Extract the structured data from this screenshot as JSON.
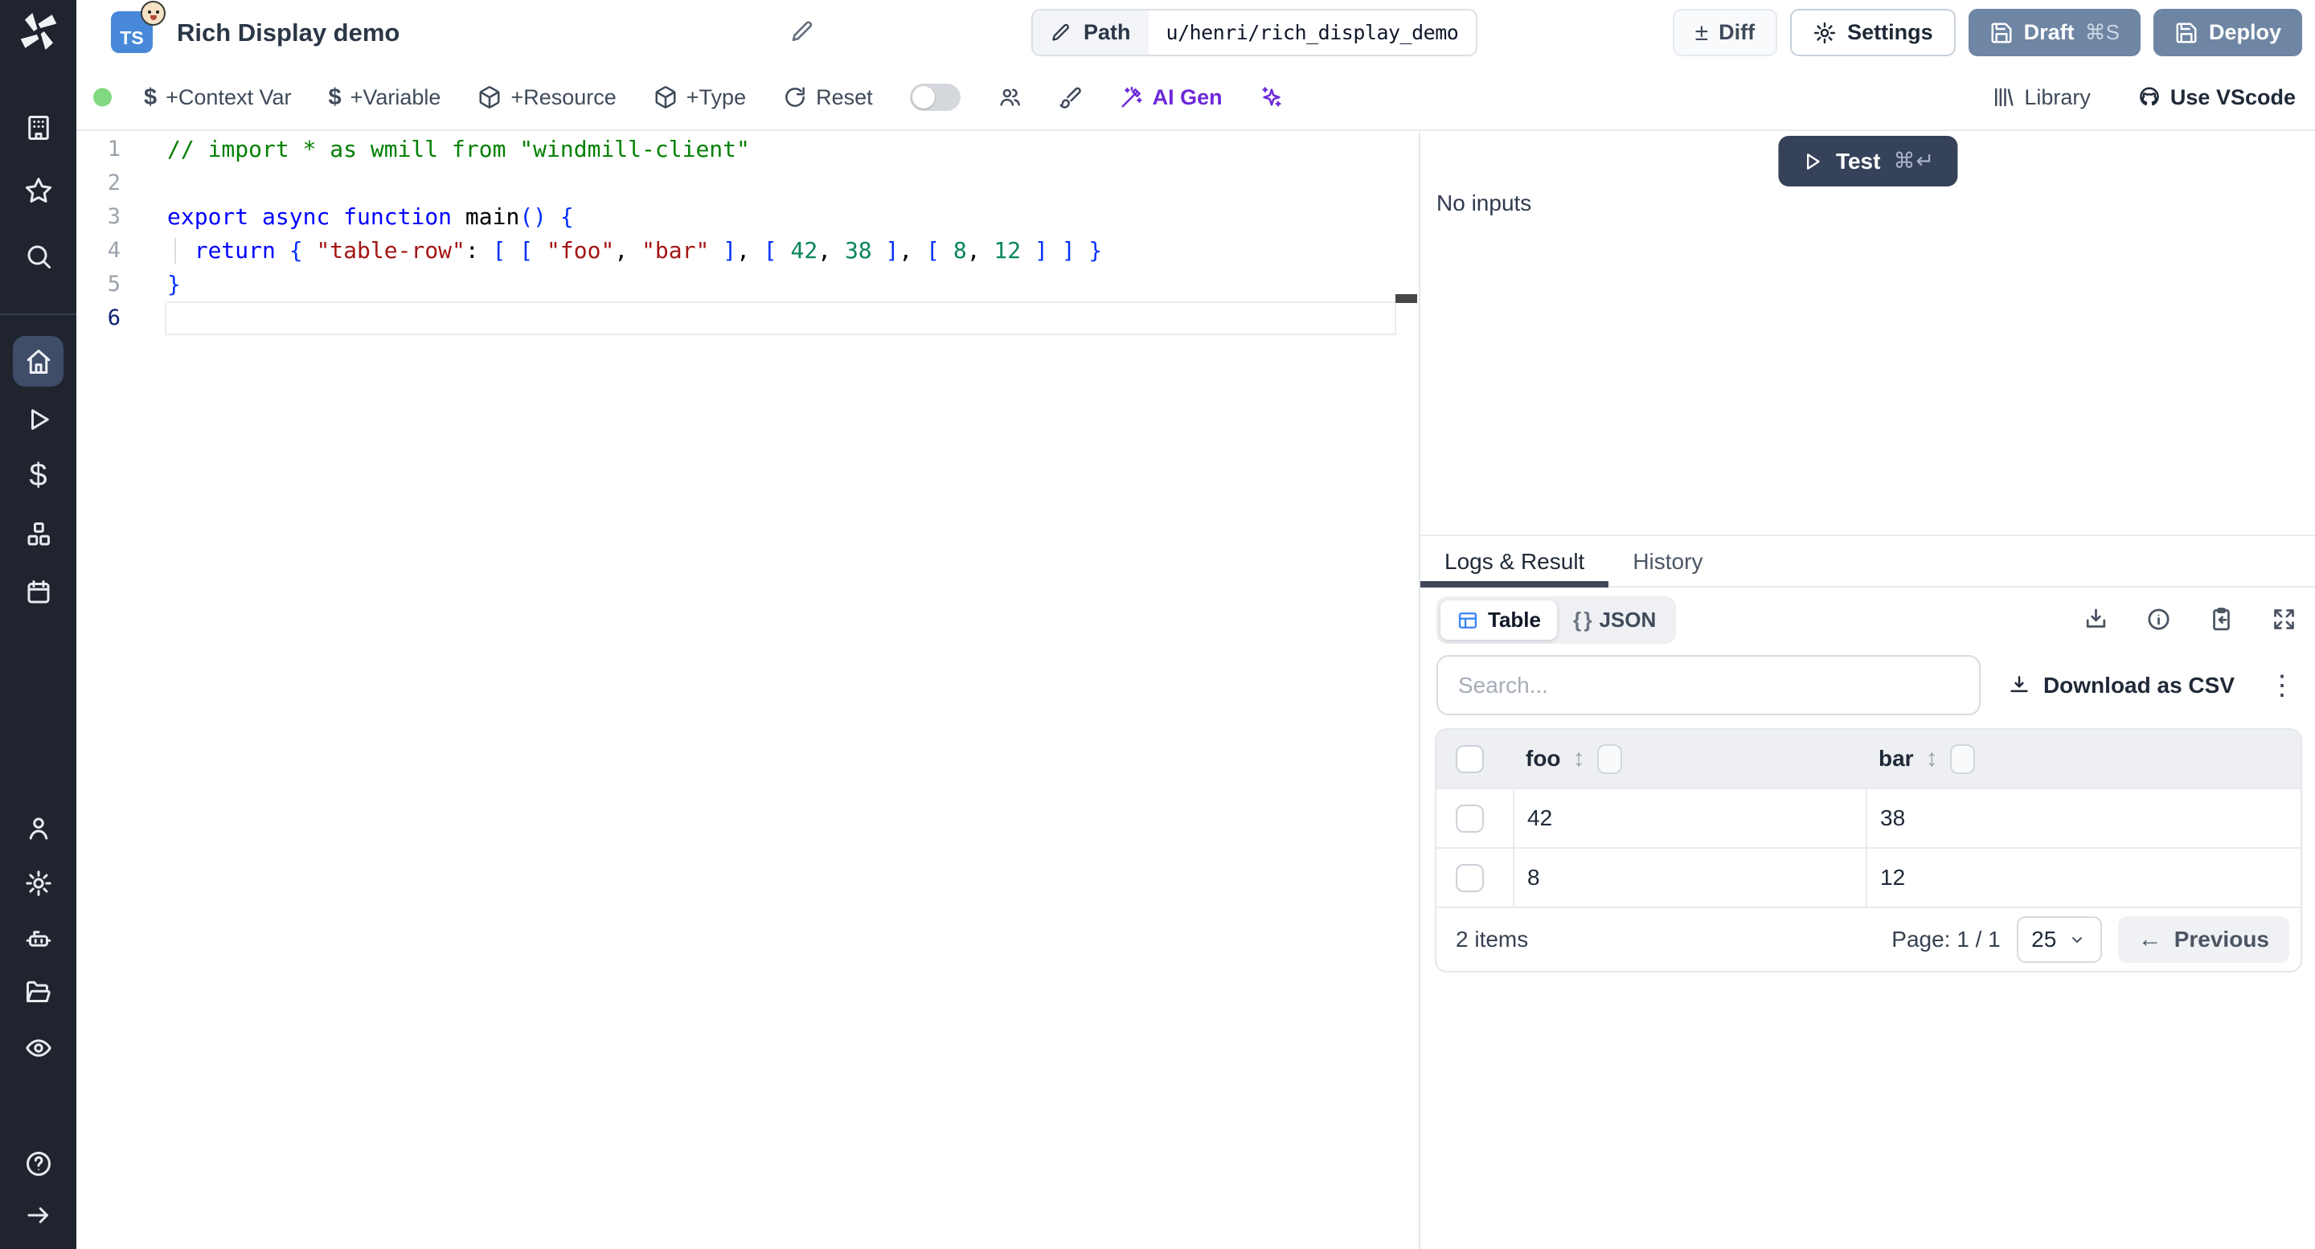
{
  "colors": {
    "sidebar_bg": "#1f242e",
    "sidebar_active_bg": "#3f4d69",
    "primary_button": "#6e85a3",
    "test_button": "#364259",
    "ai_accent": "#6d28d9",
    "table_view_icon": "#3b82f6",
    "status_dot": "#81d981",
    "ts_badge": "#4789d8",
    "tab_underline": "#3f4856"
  },
  "header": {
    "app_title": "Rich Display demo",
    "lang_badge": "TS",
    "path_label": "Path",
    "path_value": "u/henri/rich_display_demo",
    "diff_label": "Diff",
    "diff_glyph": "±",
    "settings_label": "Settings",
    "draft_label": "Draft",
    "draft_shortcut": "⌘S",
    "deploy_label": "Deploy"
  },
  "toolbar": {
    "dollar_glyph": "$",
    "context_var_label": "+Context Var",
    "variable_label": "+Variable",
    "resource_label": "+Resource",
    "type_label": "+Type",
    "reset_label": "Reset",
    "ai_gen_label": "AI Gen",
    "library_label": "Library",
    "vscode_label": "Use VScode"
  },
  "editor": {
    "active_line": "6",
    "lines": [
      {
        "n": "1",
        "tokens": [
          [
            "comment",
            "// import * as wmill from \"windmill-client\""
          ]
        ]
      },
      {
        "n": "2",
        "tokens": []
      },
      {
        "n": "3",
        "tokens": [
          [
            "kw",
            "export"
          ],
          [
            "plain",
            " "
          ],
          [
            "kw",
            "async"
          ],
          [
            "plain",
            " "
          ],
          [
            "kw",
            "function"
          ],
          [
            "plain",
            " main"
          ],
          [
            "brk",
            "()"
          ],
          [
            "plain",
            " "
          ],
          [
            "brk",
            "{"
          ]
        ]
      },
      {
        "n": "4",
        "guide": true,
        "tokens": [
          [
            "plain",
            "  "
          ],
          [
            "kw",
            "return"
          ],
          [
            "plain",
            " "
          ],
          [
            "brk",
            "{"
          ],
          [
            "plain",
            " "
          ],
          [
            "str",
            "\"table-row\""
          ],
          [
            "plain",
            ": "
          ],
          [
            "brk",
            "["
          ],
          [
            "plain",
            " "
          ],
          [
            "brk",
            "["
          ],
          [
            "plain",
            " "
          ],
          [
            "str",
            "\"foo\""
          ],
          [
            "plain",
            ", "
          ],
          [
            "str",
            "\"bar\""
          ],
          [
            "plain",
            " "
          ],
          [
            "brk",
            "]"
          ],
          [
            "plain",
            ", "
          ],
          [
            "brk",
            "["
          ],
          [
            "plain",
            " "
          ],
          [
            "num",
            "42"
          ],
          [
            "plain",
            ", "
          ],
          [
            "num",
            "38"
          ],
          [
            "plain",
            " "
          ],
          [
            "brk",
            "]"
          ],
          [
            "plain",
            ", "
          ],
          [
            "brk",
            "["
          ],
          [
            "plain",
            " "
          ],
          [
            "num",
            "8"
          ],
          [
            "plain",
            ", "
          ],
          [
            "num",
            "12"
          ],
          [
            "plain",
            " "
          ],
          [
            "brk",
            "]"
          ],
          [
            "plain",
            " "
          ],
          [
            "brk",
            "]"
          ],
          [
            "plain",
            " "
          ],
          [
            "brk",
            "}"
          ]
        ]
      },
      {
        "n": "5",
        "tokens": [
          [
            "brk",
            "}"
          ]
        ]
      },
      {
        "n": "6",
        "tokens": []
      }
    ]
  },
  "run_panel": {
    "test_label": "Test",
    "test_shortcut": "⌘↵",
    "no_inputs_label": "No inputs"
  },
  "result_panel": {
    "tab_logs": "Logs & Result",
    "tab_history": "History",
    "view_table_label": "Table",
    "view_json_label": "JSON",
    "braces_glyph": "{ }",
    "search_placeholder": "Search...",
    "download_csv_label": "Download as CSV",
    "kebab_glyph": "⋮",
    "sort_glyph": "↕",
    "table": {
      "columns": [
        "foo",
        "bar"
      ],
      "rows": [
        [
          "42",
          "38"
        ],
        [
          "8",
          "12"
        ]
      ],
      "items_count": "2 items",
      "page_indicator": "Page: 1 / 1",
      "page_size": "25",
      "previous_label": "Previous",
      "previous_arrow": "←"
    }
  }
}
